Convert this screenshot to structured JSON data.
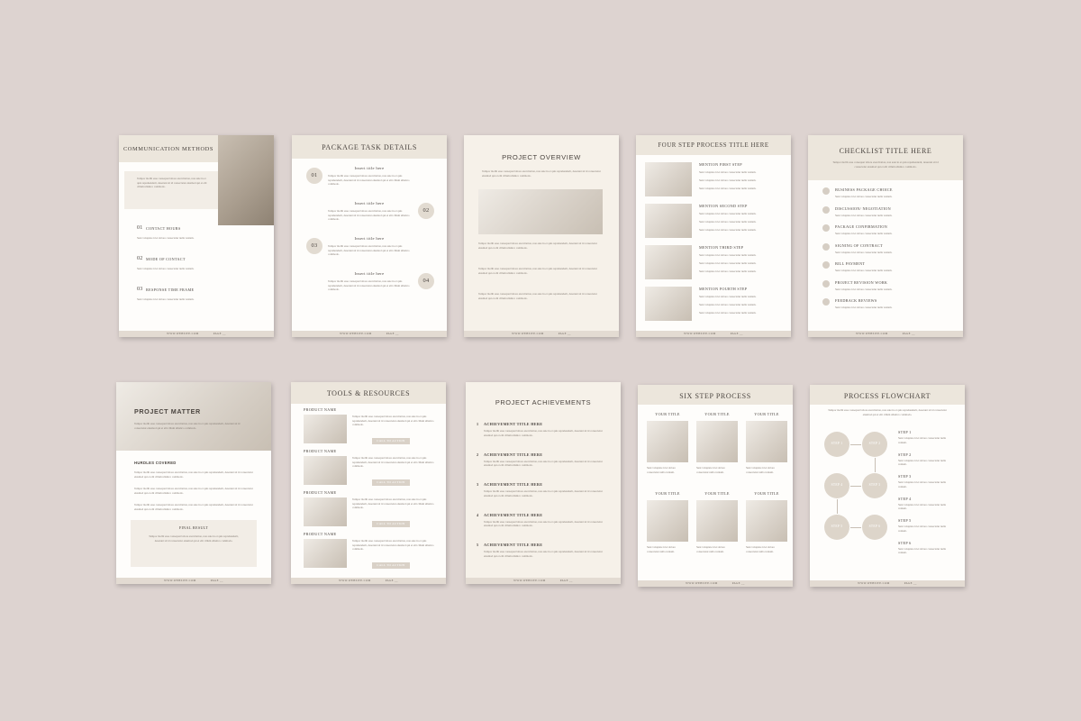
{
  "footer": {
    "site": "WWW.WEBSITE.COM",
    "page": "PAGE __"
  },
  "lorem": "Tempor mollit esse consequat labore exercitation, non aute in et quis reprehenderit, deserunt sit id consectetur eiusmod qui et elit cillum ullamco commodo.",
  "lorem_short": "Sunt voluptate id et dolore consectetur nulla veniam.",
  "pages": {
    "communication": {
      "title": "COMMUNICATION METHODS",
      "items": [
        {
          "num": "01",
          "label": "CONTACT HOURS"
        },
        {
          "num": "02",
          "label": "MODE OF CONTACT"
        },
        {
          "num": "03",
          "label": "RESPONSE TIME FRAME"
        }
      ]
    },
    "package": {
      "title": "PACKAGE  TASK DETAILS",
      "items": [
        {
          "num": "01",
          "label": "Insert title here"
        },
        {
          "num": "02",
          "label": "Insert title here"
        },
        {
          "num": "03",
          "label": "Insert title here"
        },
        {
          "num": "04",
          "label": "Insert title here"
        }
      ]
    },
    "overview": {
      "title": "PROJECT OVERVIEW"
    },
    "four_step": {
      "title": "FOUR STEP PROCESS TITLE HERE",
      "steps": [
        "MENTION FIRST STEP",
        "MENTION SECOND STEP",
        "MENTION THIRD STEP",
        "MENTION FOURTH STEP"
      ]
    },
    "checklist": {
      "title": "CHECKLIST TITLE HERE",
      "items": [
        "BUSINESS PACKAGE CHOICE",
        "DISCUSSION/ NEGOTIATION",
        "PACKAGE CONFIRMATION",
        "SIGNING OF CONTRACT",
        "BILL PAYMENT",
        "PROJECT REVISION WORK",
        "FEEDBACK REVIEWS"
      ]
    },
    "matter": {
      "title": "PROJECT MATTER",
      "sub": "HURDLES COVERED",
      "box_title": "FINAL RESULT"
    },
    "tools": {
      "title": "TOOLS & RESOURCES",
      "product_label": "PRODUCT NAME",
      "cta": "CALL TO ACTION"
    },
    "achievements": {
      "title": "PROJECT ACHIEVEMENTS",
      "items": [
        {
          "num": "1",
          "label": "ACHIEVEMENT TITLE HERE"
        },
        {
          "num": "2",
          "label": "ACHIEVEMENT TITLE HERE"
        },
        {
          "num": "3",
          "label": "ACHIEVEMENT TITLE HERE"
        },
        {
          "num": "4",
          "label": "ACHIEVEMENT TITLE HERE"
        },
        {
          "num": "5",
          "label": "ACHIEVEMENT TITLE HERE"
        }
      ]
    },
    "six_step": {
      "title": "SIX STEP PROCESS",
      "col_title": "YOUR TITLE"
    },
    "flowchart": {
      "title": "PROCESS FLOWCHART",
      "nodes": [
        "STEP 1",
        "STEP 2",
        "STEP 3",
        "STEP 4",
        "STEP 5",
        "STEP 6"
      ],
      "steps": [
        "STEP 1",
        "STEP 2",
        "STEP 3",
        "STEP 4",
        "STEP 5",
        "STEP 6"
      ]
    }
  }
}
